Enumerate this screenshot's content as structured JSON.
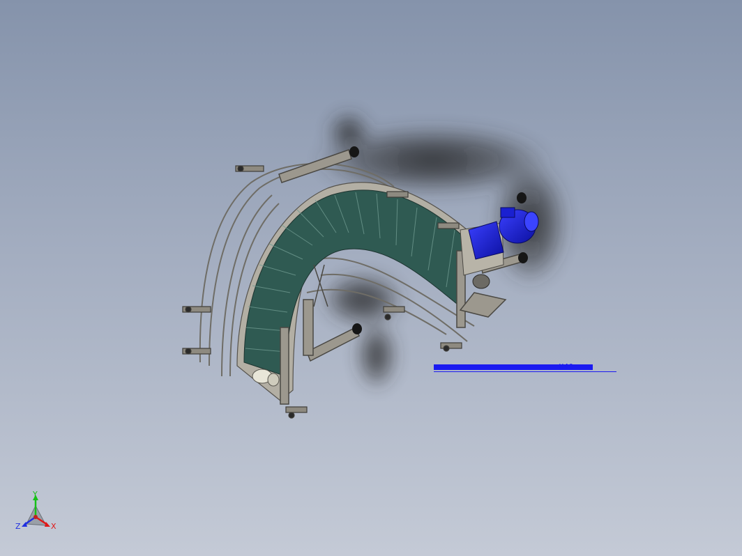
{
  "viewport": {
    "background_top": "#8593ab",
    "background_bottom": "#c4cad6"
  },
  "model": {
    "type": "curved modular belt conveyor",
    "frame_color": "#a8a49a",
    "belt_color": "#2f5a52",
    "motor_color": "#1e22e0",
    "foot_color": "#1a1a1a"
  },
  "annotation": {
    "text": "..X40",
    "color": "#1a1af0"
  },
  "triad": {
    "x_label": "X",
    "y_label": "Y",
    "z_label": "Z",
    "x_color": "#e01818",
    "y_color": "#18c018",
    "z_color": "#2030e0"
  }
}
